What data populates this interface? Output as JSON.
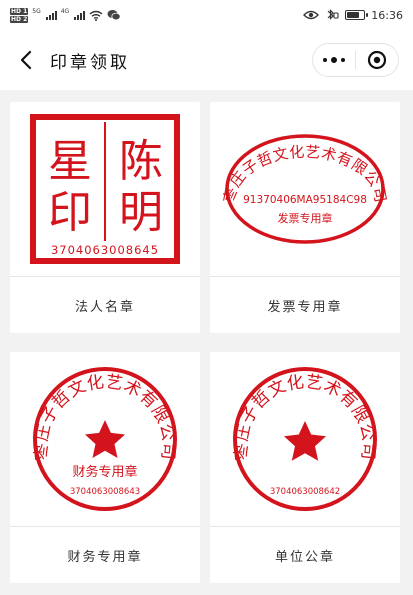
{
  "status_bar": {
    "hd1": "HD 1",
    "hd2": "HD 2",
    "sig1_tag": "5G",
    "sig2_tag": "4G",
    "time": "16:36"
  },
  "nav": {
    "title": "印章领取"
  },
  "seals": [
    {
      "label": "法人名章",
      "chars": [
        "陈",
        "星",
        "明",
        "印"
      ],
      "code": "3704063008645",
      "color": "#d4141c"
    },
    {
      "label": "发票专用章",
      "company": "枣庄子哲文化艺术有限公司",
      "tax_no": "91370406MA95184C98",
      "type_text": "发票专用章",
      "color": "#d4141c"
    },
    {
      "label": "财务专用章",
      "company": "枣庄子哲文化艺术有限公司",
      "type_text": "财务专用章",
      "code": "3704063008643",
      "color": "#d4141c"
    },
    {
      "label": "单位公章",
      "company": "枣庄子哲文化艺术有限公司",
      "code": "3704063008642",
      "color": "#d4141c"
    }
  ]
}
